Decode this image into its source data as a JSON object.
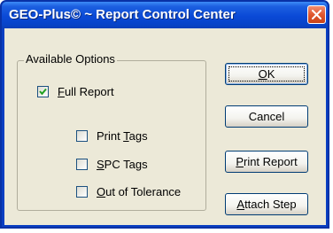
{
  "window": {
    "title": "GEO-Plus© ~ Report Control Center",
    "close_icon": "close-icon"
  },
  "options_group": {
    "label": "Available Options",
    "checkboxes": [
      {
        "pre": "",
        "accel": "F",
        "post": "ull Report",
        "checked": true
      },
      {
        "pre": "Print ",
        "accel": "T",
        "post": "ags",
        "checked": false
      },
      {
        "pre": "",
        "accel": "S",
        "post": "PC Tags",
        "checked": false
      },
      {
        "pre": "",
        "accel": "O",
        "post": "ut of Tolerance",
        "checked": false
      }
    ]
  },
  "buttons": {
    "ok": {
      "pre": "",
      "accel": "O",
      "post": "K"
    },
    "cancel": {
      "pre": "Cancel",
      "accel": "",
      "post": ""
    },
    "print_report": {
      "pre": "",
      "accel": "P",
      "post": "rint Report"
    },
    "attach_step": {
      "pre": "",
      "accel": "A",
      "post": "ttach Step"
    }
  },
  "colors": {
    "titlebar": "#0a49d6",
    "client": "#ece9d8",
    "close_button": "#e0572f"
  }
}
